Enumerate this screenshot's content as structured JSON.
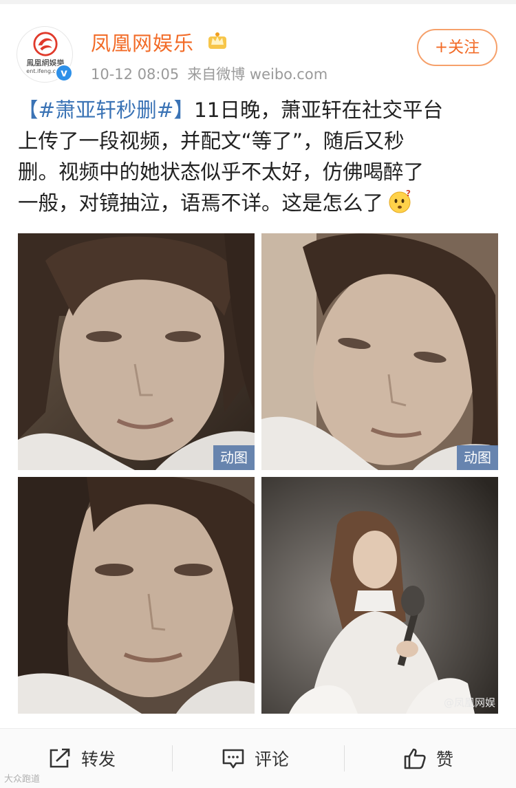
{
  "post": {
    "author": {
      "name": "凤凰网娱乐",
      "avatar_text_cn": "鳳凰網娛樂",
      "avatar_text_en": "ent.ifeng.com"
    },
    "timestamp": "10-12 08:05",
    "source": "来自微博 weibo.com",
    "follow_label": "+关注",
    "text_lines": [
      {
        "topic": "【#萧亚轩秒删#】",
        "rest": "11日晚，萧亚轩在社交平台"
      },
      {
        "rest": "上传了一段视频，并配文“等了”，随后又秒"
      },
      {
        "rest": "删。视频中的她状态似乎不太好，仿佛喝醉了"
      },
      {
        "rest": "一般，对镜抽泣，语焉不详。这是怎么了"
      }
    ],
    "images": [
      {
        "badge": "动图"
      },
      {
        "badge": "动图"
      },
      {
        "badge": ""
      },
      {
        "badge": "",
        "watermark": "@凤凰网娱"
      }
    ]
  },
  "footer": {
    "repost_label": "转发",
    "comment_label": "评论",
    "like_label": "赞"
  },
  "site_watermark": "大众跑道",
  "colors": {
    "accent_orange": "#f26b27",
    "topic_blue": "#3a73b5",
    "verified_blue": "#2e90e8",
    "gif_badge": "#5c7caa"
  }
}
